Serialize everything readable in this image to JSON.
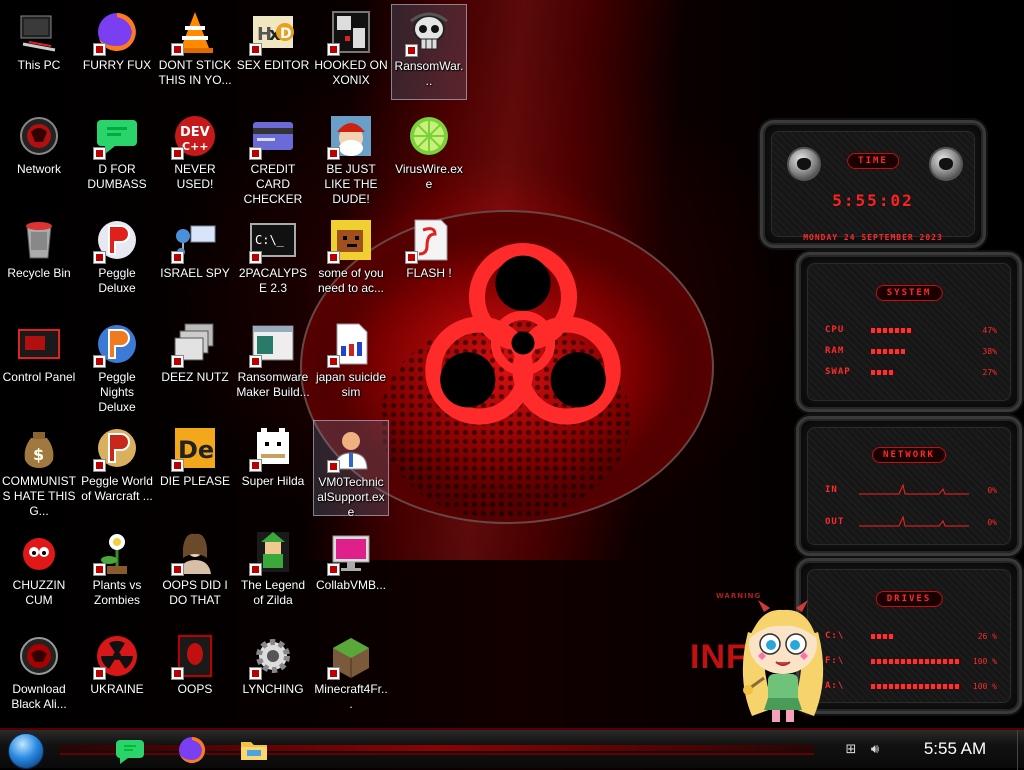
{
  "desktop": {
    "icons": [
      {
        "label": "This PC",
        "icon": "computer-icon"
      },
      {
        "label": "FURRY FUX",
        "icon": "firefox-icon"
      },
      {
        "label": "DONT STICK THIS IN YO...",
        "icon": "vlc-cone-icon"
      },
      {
        "label": "SEX EDITOR",
        "icon": "hxd-icon"
      },
      {
        "label": "HOOKED ON XONIX",
        "icon": "xonix-icon"
      },
      {
        "label": "RansomWar...",
        "icon": "skull-icon"
      },
      {
        "label": "Network",
        "icon": "network-icon"
      },
      {
        "label": "D FOR DUMBASS",
        "icon": "chat-icon"
      },
      {
        "label": "NEVER USED!",
        "icon": "devcpp-icon"
      },
      {
        "label": "CREDIT CARD CHECKER",
        "icon": "credit-card-icon"
      },
      {
        "label": "BE JUST LIKE THE DUDE!",
        "icon": "santa-icon"
      },
      {
        "label": "VirusWire.exe",
        "icon": "lime-icon"
      },
      {
        "label": "Recycle Bin",
        "icon": "recycle-bin-icon"
      },
      {
        "label": "Peggle Deluxe",
        "icon": "peggle-icon"
      },
      {
        "label": "ISRAEL SPY",
        "icon": "spy-icon"
      },
      {
        "label": "2PACALYPSE 2.3",
        "icon": "terminal-icon"
      },
      {
        "label": "some of you need to ac...",
        "icon": "pixel-dog-icon"
      },
      {
        "label": "FLASH !",
        "icon": "flash-icon"
      },
      {
        "label": "Control Panel",
        "icon": "control-panel-icon"
      },
      {
        "label": "Peggle Nights Deluxe",
        "icon": "peggle-nights-icon"
      },
      {
        "label": "DEEZ NUTZ",
        "icon": "windows-stack-icon"
      },
      {
        "label": "Ransomware Maker Build...",
        "icon": "window-app-icon"
      },
      {
        "label": "japan suicide sim",
        "icon": "document-icon"
      },
      {
        "label": "COMMUNISTS HATE THIS G...",
        "icon": "money-bag-icon"
      },
      {
        "label": "Peggle World of Warcraft ...",
        "icon": "peggle-wow-icon"
      },
      {
        "label": "DIE PLEASE",
        "icon": "de-icon"
      },
      {
        "label": "Super Hilda",
        "icon": "pixel-cat-icon"
      },
      {
        "label": "VM0TechnicalSupport.exe",
        "icon": "support-person-icon"
      },
      {
        "label": "CHUZZIN CUM",
        "icon": "chuzzle-icon"
      },
      {
        "label": "Plants vs Zombies",
        "icon": "plant-icon"
      },
      {
        "label": "OOPS DID I DO THAT",
        "icon": "portrait-icon"
      },
      {
        "label": "The Legend of Zilda",
        "icon": "link-icon"
      },
      {
        "label": "CollabVMB...",
        "icon": "monitor-icon"
      },
      {
        "label": "Download Black Ali...",
        "icon": "alien-orb-icon"
      },
      {
        "label": "UKRAINE",
        "icon": "radiation-icon"
      },
      {
        "label": "OOPS",
        "icon": "alienware-icon"
      },
      {
        "label": "LYNCHING",
        "icon": "settings-gear-icon"
      },
      {
        "label": "Minecraft4Fr...",
        "icon": "minecraft-grass-icon"
      }
    ]
  },
  "widgets": {
    "time": {
      "title": "TIME",
      "clock": "5:55:02",
      "date": "MONDAY 24 SEPTEMBER 2023"
    },
    "system": {
      "title": "SYSTEM",
      "rows": [
        {
          "label": "CPU",
          "value": "47%",
          "level": 0.47
        },
        {
          "label": "RAM",
          "value": "38%",
          "level": 0.38
        },
        {
          "label": "SWAP",
          "value": "27%",
          "level": 0.27
        }
      ]
    },
    "network": {
      "title": "NETWORK",
      "rows": [
        {
          "label": "IN",
          "value": "0%"
        },
        {
          "label": "OUT",
          "value": "0%"
        }
      ]
    },
    "drives": {
      "title": "DRIVES",
      "rows": [
        {
          "label": "C:\\",
          "value": "26 %",
          "level": 0.26
        },
        {
          "label": "F:\\",
          "value": "100 %",
          "level": 1.0
        },
        {
          "label": "A:\\",
          "value": "100 %",
          "level": 1.0
        }
      ]
    }
  },
  "background": {
    "warning_text": "WARNING",
    "big_text": "INF"
  },
  "taskbar": {
    "start_label": "Start",
    "pinned": [
      {
        "name": "Chat",
        "icon": "chat-icon"
      },
      {
        "name": "Firefox",
        "icon": "firefox-icon"
      },
      {
        "name": "File Explorer",
        "icon": "folder-icon"
      }
    ],
    "clock": "5:55 AM"
  },
  "colors": {
    "accent": "#ff2020",
    "widget_bg": "#141414",
    "taskbar_accent": "#a00000"
  }
}
